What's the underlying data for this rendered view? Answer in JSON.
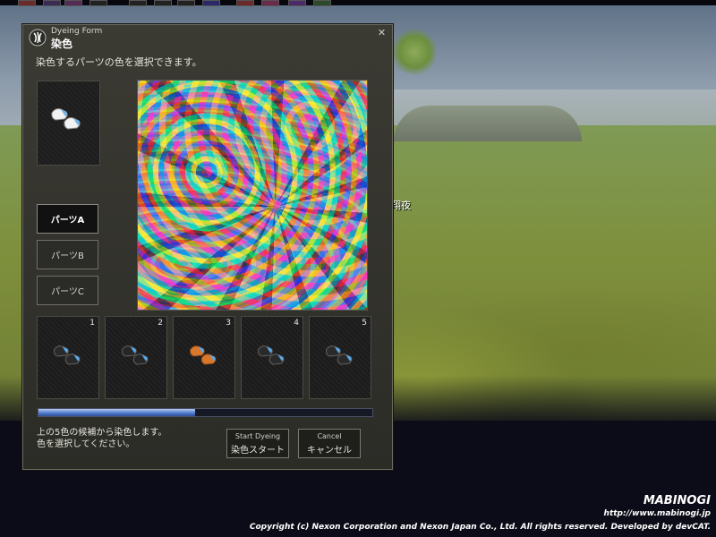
{
  "scene": {
    "label": "翔夜"
  },
  "dialog": {
    "title_en": "Dyeing Form",
    "title_jp": "染色",
    "close_icon": "close-icon",
    "instruction": "染色するパーツの色を選択できます。",
    "parts": [
      {
        "label": "パーツA",
        "active": true
      },
      {
        "label": "パーツB",
        "active": false
      },
      {
        "label": "パーツC",
        "active": false
      }
    ],
    "slots": [
      {
        "number": "1",
        "color": "#2a2a2a"
      },
      {
        "number": "2",
        "color": "#262626"
      },
      {
        "number": "3",
        "color": "#d9772b"
      },
      {
        "number": "4",
        "color": "#2a2a2a"
      },
      {
        "number": "5",
        "color": "#2a2a2a"
      }
    ],
    "progress_fraction": 0.47,
    "note_line1": "上の5色の候補から染色します。",
    "note_line2": "色を選択してください。",
    "start_button": {
      "en": "Start Dyeing",
      "jp": "染色スタート"
    },
    "cancel_button": {
      "en": "Cancel",
      "jp": "キャンセル"
    }
  },
  "footer": {
    "brand": "MABINOGI",
    "url": "http://www.mabinogi.jp",
    "copyright": "Copyright (c) Nexon Corporation and Nexon Japan Co., Ltd. All rights reserved. Developed by devCAT."
  },
  "colors": {
    "accent": "#4d77c9",
    "shoe_toe": "#5aa8e8"
  }
}
